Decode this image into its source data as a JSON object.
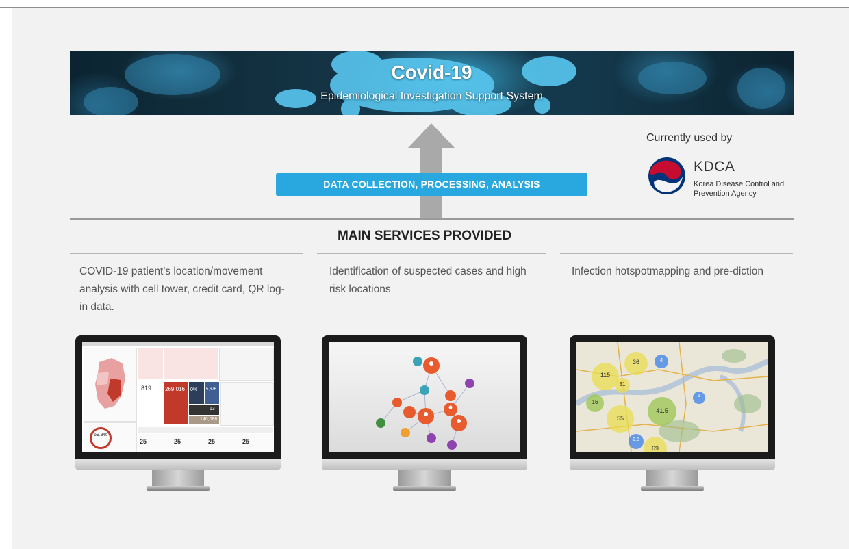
{
  "banner": {
    "title": "Covid-19",
    "subtitle": "Epidemiological Investigation Support System"
  },
  "pipeline_label": "DATA COLLECTION, PROCESSING, ANALYSIS",
  "partner": {
    "used_label": "Currently used by",
    "name": "KDCA",
    "full_name": "Korea Disease Control and Prevention Agency",
    "logo_colors": [
      "#c60c30",
      "#003478"
    ]
  },
  "section_title": "MAIN SERVICES PROVIDED",
  "services": [
    {
      "description": "COVID-19 patient's location/movement analysis with cell tower, credit card, QR log-in data.",
      "screen": "dashboard"
    },
    {
      "description": "Identification of suspected cases and high risk locations",
      "screen": "network-graph"
    },
    {
      "description": "Infection hotspotmapping and pre-diction",
      "screen": "hotspot-map"
    }
  ],
  "dashboard": {
    "stats": [
      "819",
      "269,016",
      "0%",
      "5,676",
      "13",
      "140,088",
      "69.3%"
    ],
    "day_values": [
      "25",
      "25",
      "25",
      "25"
    ]
  },
  "map": {
    "clusters": [
      "36",
      "4",
      "115",
      "31",
      "16",
      "55",
      "41.5",
      "2.5",
      "69",
      "1"
    ]
  },
  "colors": {
    "accent_blue": "#29a8e0",
    "dashboard_red": "#c0392b",
    "background": "#f2f2f2"
  }
}
